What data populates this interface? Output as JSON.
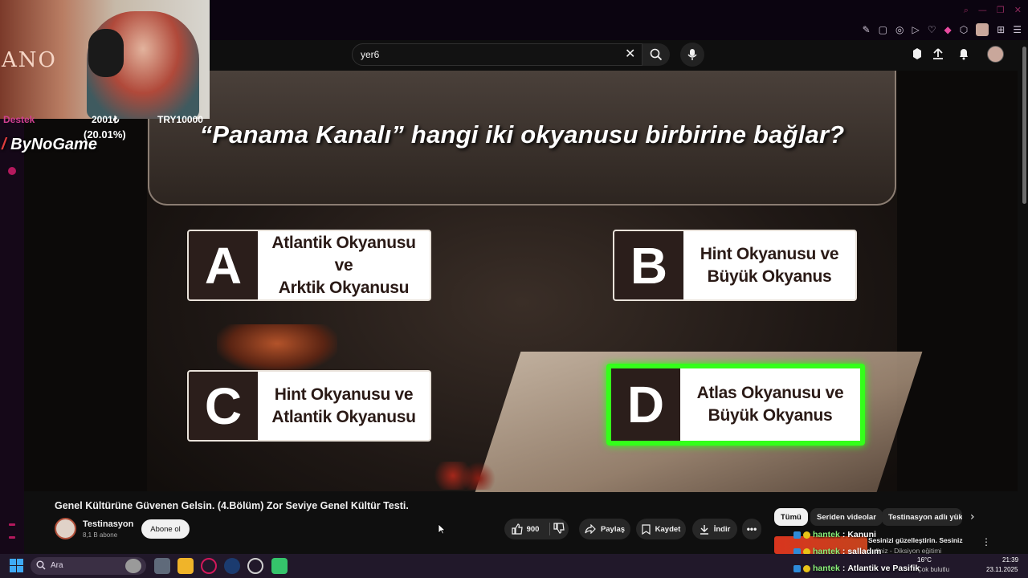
{
  "browser": {
    "icons": [
      "pin-icon",
      "tab-icon",
      "shield-icon",
      "play-icon",
      "heart-icon",
      "extension-icon",
      "profile-icon",
      "menu-icon"
    ]
  },
  "stream_overlay": {
    "support_label": "Destek",
    "support_amount": "2001₺",
    "support_percent": "(20.01%)",
    "support_goal": "TRY10000",
    "channel_logo": "ByNoGame",
    "cam_text": "ANO"
  },
  "search": {
    "value": "yer6"
  },
  "video": {
    "question": "“Panama Kanalı” hangi iki okyanusu birbirine bağlar?",
    "options": [
      {
        "letter": "A",
        "line1": "Atlantik Okyanusu ve",
        "line2": "Arktik Okyanusu",
        "correct": false
      },
      {
        "letter": "B",
        "line1": "Hint Okyanusu ve",
        "line2": "Büyük Okyanus",
        "correct": false
      },
      {
        "letter": "C",
        "line1": "Hint Okyanusu ve",
        "line2": "Atlantik Okyanusu",
        "correct": false
      },
      {
        "letter": "D",
        "line1": "Atlas Okyanusu ve",
        "line2": "Büyük Okyanus",
        "correct": true
      }
    ],
    "highlight_color": "#34ff1a"
  },
  "details": {
    "title": "Genel Kültürüne Güvenen Gelsin. (4.Bölüm) Zor Seviye Genel Kültür Testi.",
    "channel": "Testinasyon",
    "subscribers": "8,1 B abone",
    "subscribe_label": "Abone ol",
    "likes": "900",
    "share_label": "Paylaş",
    "save_label": "Kaydet",
    "download_label": "İndir"
  },
  "chips": [
    "Tümü",
    "Seriden videolar",
    "Testinasyon adlı yüklemeler"
  ],
  "related": {
    "line1": "Sesinizi güzelleştirin. Sesiniz",
    "line2": "...diniz - Diksiyon eğitimi"
  },
  "chat": [
    {
      "user": "hantek",
      "message": "Kanuni"
    },
    {
      "user": "hantek",
      "message": "salladım"
    },
    {
      "user": "hantek",
      "message": "Atlantik ve Pasifik"
    }
  ],
  "taskbar": {
    "search_placeholder": "Ara",
    "temperature": "16°C",
    "weather": "Çok bulutlu",
    "time": "21:39",
    "date": "23.11.2025"
  }
}
